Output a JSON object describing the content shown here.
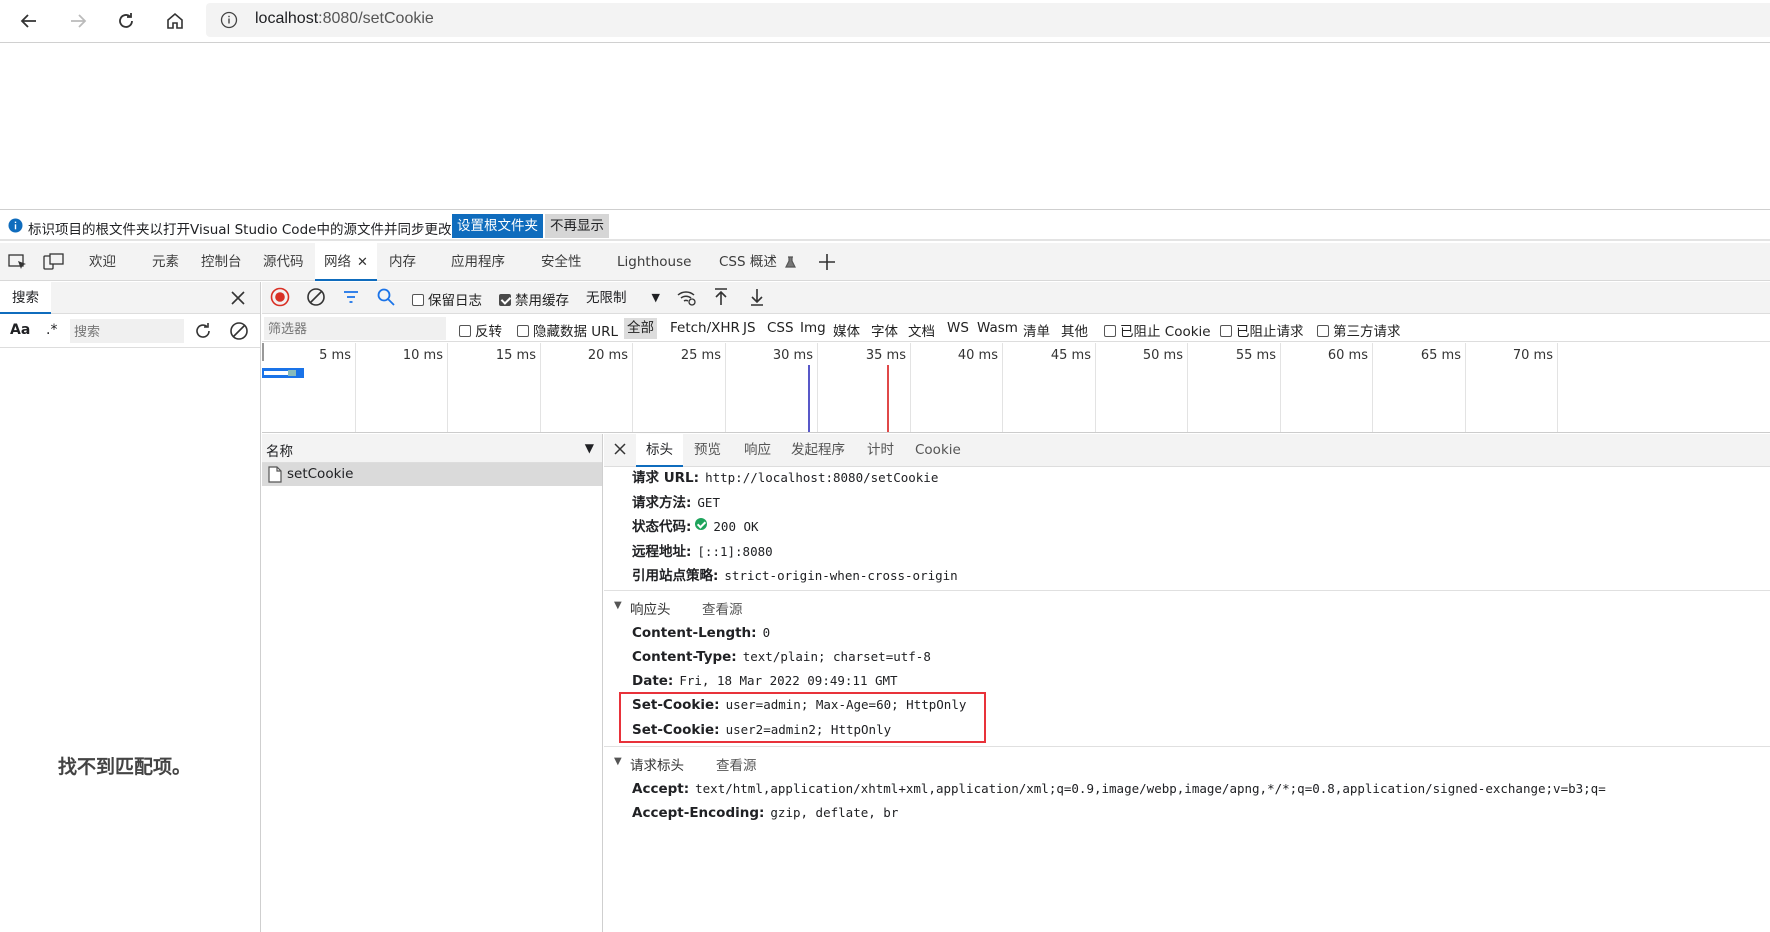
{
  "browser": {
    "url_host": "localhost",
    "url_rest": ":8080/setCookie"
  },
  "infobar": {
    "message": "标识项目的根文件夹以打开Visual Studio Code中的源文件并同步更改。",
    "primary_button": "设置根文件夹",
    "secondary_button": "不再显示"
  },
  "devtools_tabs": {
    "welcome": "欢迎",
    "elements": "元素",
    "console": "控制台",
    "sources": "源代码",
    "network": "网络",
    "memory": "内存",
    "application": "应用程序",
    "security": "安全性",
    "lighthouse": "Lighthouse",
    "css_overview": "CSS 概述"
  },
  "search_panel": {
    "tab_label": "搜索",
    "case_label": "Aa",
    "regex_label": ".*",
    "placeholder": "搜索",
    "empty_message": "找不到匹配项。"
  },
  "network_toolbar": {
    "preserve_log": "保留日志",
    "preserve_log_checked": false,
    "disable_cache": "禁用缓存",
    "disable_cache_checked": true,
    "throttling": "无限制"
  },
  "filter_bar": {
    "placeholder": "筛选器",
    "invert": "反转",
    "hide_data_urls": "隐藏数据 URL",
    "types": [
      "全部",
      "Fetch/XHR",
      "JS",
      "CSS",
      "Img",
      "媒体",
      "字体",
      "文档",
      "WS",
      "Wasm",
      "清单",
      "其他"
    ],
    "blocked_cookies": "已阻止 Cookie",
    "blocked_requests": "已阻止请求",
    "third_party": "第三方请求"
  },
  "overview": {
    "ticks": [
      "5 ms",
      "10 ms",
      "15 ms",
      "20 ms",
      "25 ms",
      "30 ms",
      "35 ms",
      "40 ms",
      "45 ms",
      "50 ms",
      "55 ms",
      "60 ms",
      "65 ms",
      "70 ms"
    ],
    "dom_content_loaded_ms": 29.5,
    "load_ms": 33.8
  },
  "requests": {
    "column_name": "名称",
    "rows": [
      "setCookie"
    ]
  },
  "details": {
    "tabs": [
      "标头",
      "预览",
      "响应",
      "发起程序",
      "计时",
      "Cookie"
    ],
    "general": {
      "url_k": "请求 URL:",
      "url_v": "http://localhost:8080/setCookie",
      "method_k": "请求方法:",
      "method_v": "GET",
      "status_k": "状态代码:",
      "status_v": "200 OK",
      "remote_k": "远程地址:",
      "remote_v": "[::1]:8080",
      "policy_k": "引用站点策略:",
      "policy_v": "strict-origin-when-cross-origin"
    },
    "response_headers": {
      "title": "响应头",
      "view_source": "查看源",
      "content_length_k": "Content-Length:",
      "content_length_v": "0",
      "content_type_k": "Content-Type:",
      "content_type_v": "text/plain; charset=utf-8",
      "date_k": "Date:",
      "date_v": "Fri, 18 Mar 2022 09:49:11 GMT",
      "set_cookie1_k": "Set-Cookie:",
      "set_cookie1_v": "user=admin; Max-Age=60; HttpOnly",
      "set_cookie2_k": "Set-Cookie:",
      "set_cookie2_v": "user2=admin2; HttpOnly"
    },
    "request_headers": {
      "title": "请求标头",
      "view_source": "查看源",
      "accept_k": "Accept:",
      "accept_v": "text/html,application/xhtml+xml,application/xml;q=0.9,image/webp,image/apng,*/*;q=0.8,application/signed-exchange;v=b3;q=",
      "encoding_k": "Accept-Encoding:",
      "encoding_v": "gzip, deflate, br"
    }
  }
}
